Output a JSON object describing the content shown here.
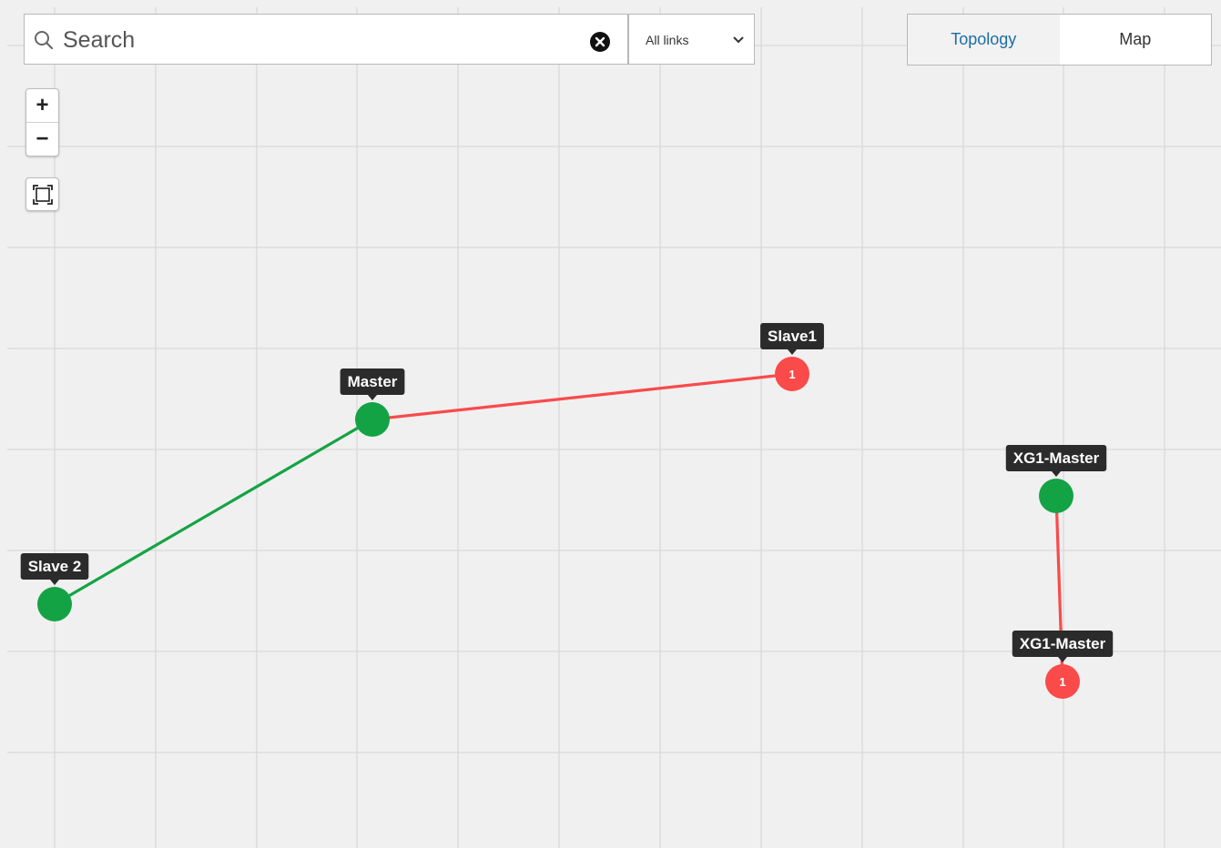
{
  "search": {
    "placeholder": "Search"
  },
  "link_filter": {
    "selected": "All links"
  },
  "view_tabs": [
    {
      "label": "Topology",
      "active": true
    },
    {
      "label": "Map",
      "active": false
    }
  ],
  "zoom": {
    "in_label": "+",
    "out_label": "−"
  },
  "colors": {
    "online": "#14a344",
    "offline": "#fa4a4a",
    "label_bg": "#2b2b2b",
    "grid": "#d9d9d9",
    "background": "#f0f0f0",
    "accent": "#1c6ea4"
  },
  "topology": {
    "nodes": [
      {
        "id": "master",
        "label": "Master",
        "status": "online",
        "badge": ""
      },
      {
        "id": "slave1",
        "label": "Slave1",
        "status": "offline",
        "badge": "1"
      },
      {
        "id": "slave2",
        "label": "Slave 2",
        "status": "online",
        "badge": ""
      },
      {
        "id": "xg1-master-a",
        "label": "XG1-Master",
        "status": "online",
        "badge": ""
      },
      {
        "id": "xg1-master-b",
        "label": "XG1-Master",
        "status": "offline",
        "badge": "1"
      }
    ],
    "links": [
      {
        "from": "master",
        "to": "slave1",
        "status": "offline"
      },
      {
        "from": "master",
        "to": "slave2",
        "status": "online"
      },
      {
        "from": "xg1-master-a",
        "to": "xg1-master-b",
        "status": "offline"
      }
    ]
  }
}
